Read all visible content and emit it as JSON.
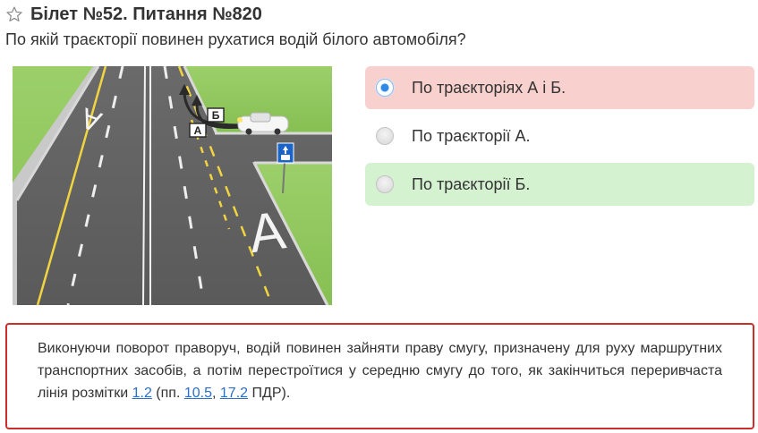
{
  "header": {
    "title": "Білет №52. Питання №820",
    "icon": "star-outline-icon"
  },
  "question": "По якій траєкторії повинен рухатися водій білого автомобіля?",
  "scene": {
    "trajectory_labels": [
      "А",
      "Б"
    ],
    "road_letters": [
      "А",
      "А"
    ],
    "sign_icon": "bus-lane-sign-icon"
  },
  "answers": [
    {
      "label": "По траєкторіях А і Б.",
      "state": "selected-wrong"
    },
    {
      "label": "По траєкторії А.",
      "state": "neutral"
    },
    {
      "label": "По траєкторії Б.",
      "state": "correct"
    }
  ],
  "colors": {
    "wrong_bg": "#f8d0cd",
    "correct_bg": "#d4f1d0",
    "explanation_border": "#c9302c",
    "link": "#2a6fc9"
  },
  "explanation": {
    "text_before": "Виконуючи поворот праворуч, водій повинен зайняти праву смугу, призначену для руху маршрутних транспортних засобів, а потім перестроїтися у середню смугу до того, як закінчиться переривчаста лінія розмітки ",
    "link_1": "1.2",
    "text_mid_1": " (пп. ",
    "link_2": "10.5",
    "text_mid_2": ", ",
    "link_3": "17.2",
    "text_after": " ПДР)."
  }
}
